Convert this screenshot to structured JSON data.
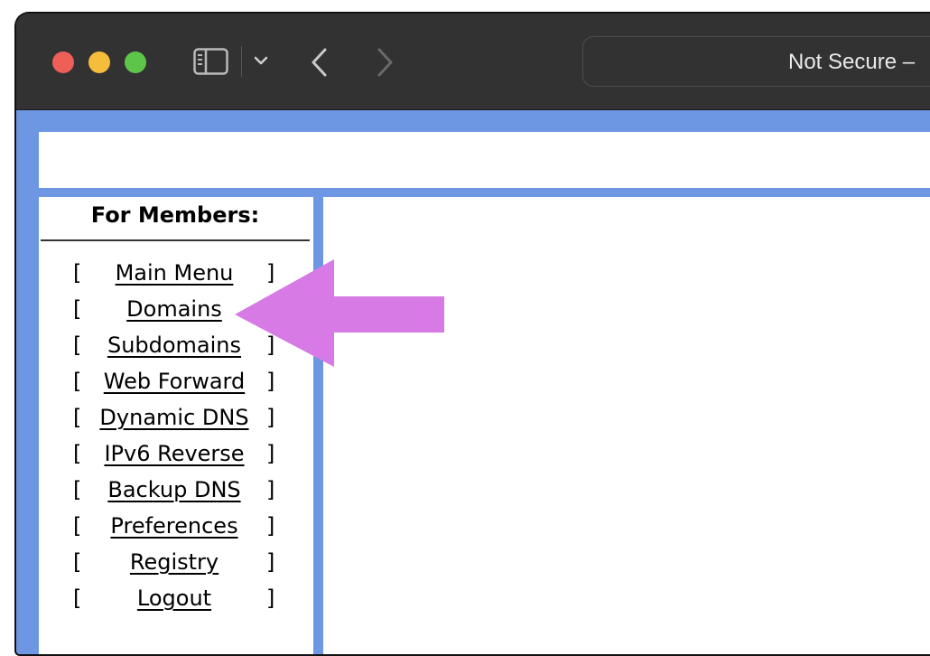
{
  "browser": {
    "url_text": "Not Secure –",
    "traffic_lights": {
      "close": "#ee5f58",
      "minimize": "#f6bd3b",
      "maximize": "#5ec54b"
    },
    "icons": [
      "sidebar-icon",
      "chevron-down-icon",
      "back-arrow-icon",
      "forward-arrow-icon"
    ]
  },
  "page": {
    "background_color": "#6d97e2",
    "sidebar": {
      "heading": "For Members:",
      "bracket_open": "[",
      "bracket_close": "]",
      "items": [
        {
          "label": "Main Menu"
        },
        {
          "label": "Domains"
        },
        {
          "label": "Subdomains"
        },
        {
          "label": "Web Forward"
        },
        {
          "label": "Dynamic DNS"
        },
        {
          "label": "IPv6 Reverse"
        },
        {
          "label": "Backup DNS"
        },
        {
          "label": "Preferences"
        },
        {
          "label": "Registry"
        },
        {
          "label": "Logout"
        }
      ]
    }
  },
  "annotation": {
    "arrow_color": "#d77ae5",
    "points_to": "Domains"
  }
}
